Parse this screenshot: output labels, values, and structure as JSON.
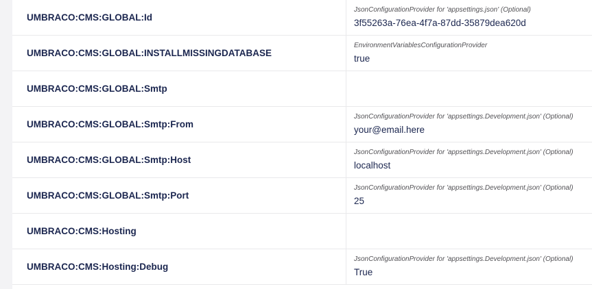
{
  "rows": [
    {
      "key": "UMBRACO:CMS:GLOBAL:Id",
      "provider": "JsonConfigurationProvider for 'appsettings.json' (Optional)",
      "value": "3f55263a-76ea-4f7a-87dd-35879dea620d"
    },
    {
      "key": "UMBRACO:CMS:GLOBAL:INSTALLMISSINGDATABASE",
      "provider": "EnvironmentVariablesConfigurationProvider",
      "value": "true"
    },
    {
      "key": "UMBRACO:CMS:GLOBAL:Smtp",
      "provider": "",
      "value": ""
    },
    {
      "key": "UMBRACO:CMS:GLOBAL:Smtp:From",
      "provider": "JsonConfigurationProvider for 'appsettings.Development.json' (Optional)",
      "value": "your@email.here"
    },
    {
      "key": "UMBRACO:CMS:GLOBAL:Smtp:Host",
      "provider": "JsonConfigurationProvider for 'appsettings.Development.json' (Optional)",
      "value": "localhost"
    },
    {
      "key": "UMBRACO:CMS:GLOBAL:Smtp:Port",
      "provider": "JsonConfigurationProvider for 'appsettings.Development.json' (Optional)",
      "value": "25"
    },
    {
      "key": "UMBRACO:CMS:Hosting",
      "provider": "",
      "value": ""
    },
    {
      "key": "UMBRACO:CMS:Hosting:Debug",
      "provider": "JsonConfigurationProvider for 'appsettings.Development.json' (Optional)",
      "value": "True"
    }
  ]
}
